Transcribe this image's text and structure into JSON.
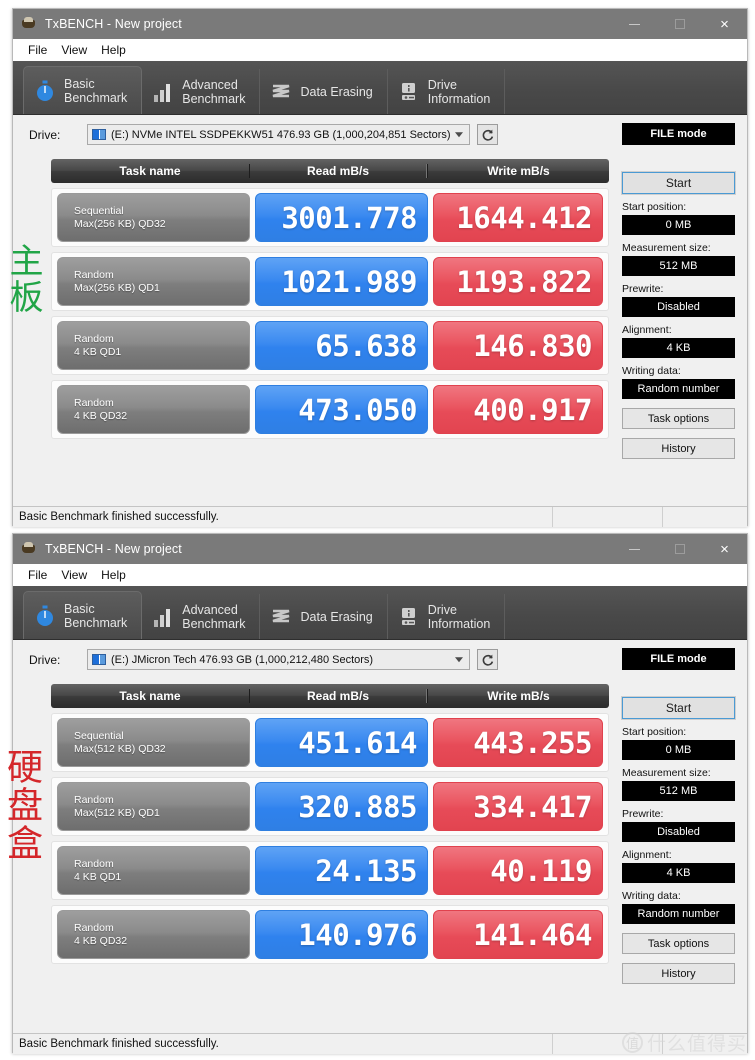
{
  "windows": [
    {
      "id": "window-1",
      "title": "TxBENCH - New project",
      "app_icon": "txbench-app-icon",
      "menu": [
        "File",
        "View",
        "Help"
      ],
      "tabs": [
        {
          "label": "Basic\nBenchmark",
          "icon": "stopwatch-icon",
          "active": true
        },
        {
          "label": "Advanced\nBenchmark",
          "icon": "bar-chart-icon",
          "active": false
        },
        {
          "label": "Data Erasing",
          "icon": "shred-icon",
          "active": false
        },
        {
          "label": "Drive\nInformation",
          "icon": "drive-info-icon",
          "active": false
        }
      ],
      "drive": {
        "label": "Drive:",
        "value": "(E:) NVMe INTEL SSDPEKKW51  476.93 GB (1,000,204,851 Sectors)",
        "refresh_icon": "refresh-icon",
        "caret_icon": "chevron-down-icon"
      },
      "table": {
        "headers": [
          "Task name",
          "Read mB/s",
          "Write mB/s"
        ],
        "rows": [
          {
            "task_line1": "Sequential",
            "task_line2": "Max(256 KB) QD32",
            "read": "3001.778",
            "write": "1644.412"
          },
          {
            "task_line1": "Random",
            "task_line2": "Max(256 KB) QD1",
            "read": "1021.989",
            "write": "1193.822"
          },
          {
            "task_line1": "Random",
            "task_line2": "4 KB QD1",
            "read": "65.638",
            "write": "146.830"
          },
          {
            "task_line1": "Random",
            "task_line2": "4 KB QD32",
            "read": "473.050",
            "write": "400.917"
          }
        ]
      },
      "panel": {
        "mode": "FILE mode",
        "start_label": "Start",
        "fields": [
          {
            "label": "Start position:",
            "value": "0 MB"
          },
          {
            "label": "Measurement size:",
            "value": "512 MB"
          },
          {
            "label": "Prewrite:",
            "value": "Disabled"
          },
          {
            "label": "Alignment:",
            "value": "4 KB"
          },
          {
            "label": "Writing data:",
            "value": "Random number"
          }
        ],
        "buttons": [
          "Task options",
          "History"
        ]
      },
      "status": "Basic Benchmark finished successfully.",
      "window_controls": {
        "minimize": "minimize-icon",
        "maximize": "maximize-icon",
        "close": "×"
      }
    },
    {
      "id": "window-2",
      "title": "TxBENCH - New project",
      "app_icon": "txbench-app-icon",
      "menu": [
        "File",
        "View",
        "Help"
      ],
      "tabs": [
        {
          "label": "Basic\nBenchmark",
          "icon": "stopwatch-icon",
          "active": true
        },
        {
          "label": "Advanced\nBenchmark",
          "icon": "bar-chart-icon",
          "active": false
        },
        {
          "label": "Data Erasing",
          "icon": "shred-icon",
          "active": false
        },
        {
          "label": "Drive\nInformation",
          "icon": "drive-info-icon",
          "active": false
        }
      ],
      "drive": {
        "label": "Drive:",
        "value": "(E:) JMicron Tech  476.93 GB (1,000,212,480 Sectors)",
        "refresh_icon": "refresh-icon",
        "caret_icon": "chevron-down-icon"
      },
      "table": {
        "headers": [
          "Task name",
          "Read mB/s",
          "Write mB/s"
        ],
        "rows": [
          {
            "task_line1": "Sequential",
            "task_line2": "Max(512 KB) QD32",
            "read": "451.614",
            "write": "443.255"
          },
          {
            "task_line1": "Random",
            "task_line2": "Max(512 KB) QD1",
            "read": "320.885",
            "write": "334.417"
          },
          {
            "task_line1": "Random",
            "task_line2": "4 KB QD1",
            "read": "24.135",
            "write": "40.119"
          },
          {
            "task_line1": "Random",
            "task_line2": "4 KB QD32",
            "read": "140.976",
            "write": "141.464"
          }
        ]
      },
      "panel": {
        "mode": "FILE mode",
        "start_label": "Start",
        "fields": [
          {
            "label": "Start position:",
            "value": "0 MB"
          },
          {
            "label": "Measurement size:",
            "value": "512 MB"
          },
          {
            "label": "Prewrite:",
            "value": "Disabled"
          },
          {
            "label": "Alignment:",
            "value": "4 KB"
          },
          {
            "label": "Writing data:",
            "value": "Random number"
          }
        ],
        "buttons": [
          "Task options",
          "History"
        ]
      },
      "status": "Basic Benchmark finished successfully.",
      "window_controls": {
        "minimize": "minimize-icon",
        "maximize": "maximize-icon",
        "close": "×"
      }
    }
  ],
  "annotations": {
    "motherboard": "主板",
    "enclosure": "硬盘盒"
  },
  "watermark": {
    "mark": "值",
    "text": "什么值得买"
  },
  "colors": {
    "read_blue": "#3b8af0",
    "write_red": "#ea5560",
    "titlebar": "#7a7a7a",
    "tabstrip": "#4c4c4c",
    "annotation_green": "#21a547",
    "annotation_red": "#d4262a"
  }
}
